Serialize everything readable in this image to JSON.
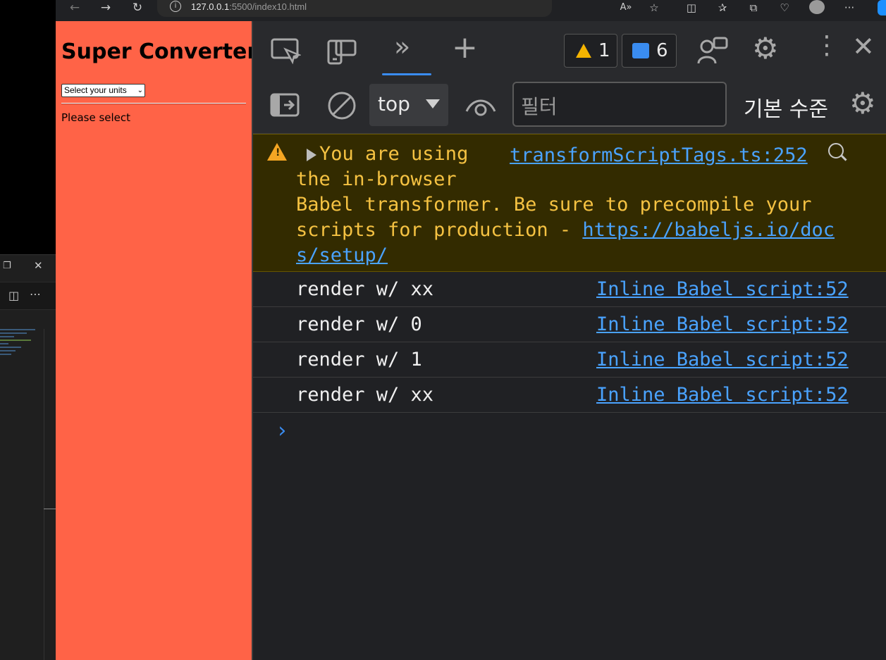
{
  "browser": {
    "url_host": "127.0.0.1",
    "url_rest": ":5500/index10.html"
  },
  "page": {
    "title": "Super Converter",
    "select_value": "Select your units",
    "status_text": "Please select"
  },
  "devtools": {
    "warning_count": "1",
    "message_count": "6",
    "context": "top",
    "filter_placeholder": "필터",
    "level_label": "기본 수준",
    "warning": {
      "line1": "You are using",
      "line2": "the in-browser",
      "line3": "Babel transformer. Be sure to precompile your",
      "line4": "scripts for production - ",
      "link_part1": "https://babeljs.io/doc",
      "link_part2": "s/setup/",
      "source": "transformScriptTags.ts:252"
    },
    "logs": [
      {
        "message": "render w/ xx",
        "source": "Inline Babel script:52"
      },
      {
        "message": "render w/ 0",
        "source": "Inline Babel script:52"
      },
      {
        "message": "render w/ 1",
        "source": "Inline Babel script:52"
      },
      {
        "message": "render w/ xx",
        "source": "Inline Babel script:52"
      }
    ]
  },
  "colors": {
    "page_background": "#ff6347",
    "devtools_background": "#202124",
    "warning_background": "#332b00",
    "warning_text": "#f5c242",
    "link": "#4aa3ff",
    "accent": "#3a8cf0"
  }
}
